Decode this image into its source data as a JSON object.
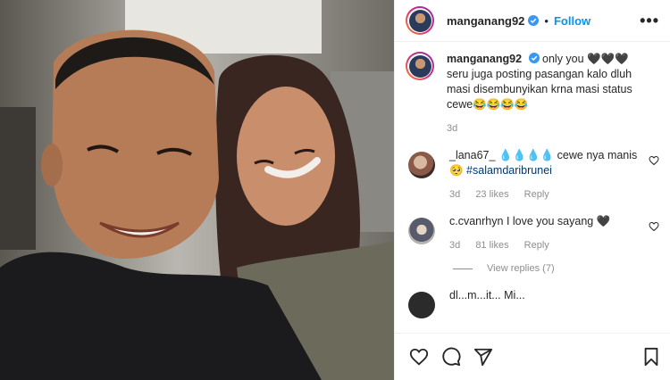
{
  "header": {
    "username": "manganang92",
    "separator": "•",
    "follow_label": "Follow",
    "more_label": "•••"
  },
  "caption": {
    "username": "manganang92",
    "text": "only you 🖤🖤🖤 seru juga posting pasangan kalo dluh masi disembunyikan krna masi status cewe😂😂😂😂",
    "time": "3d"
  },
  "comments": [
    {
      "username": "_lana67_",
      "text": "💧💧💧💧 cewe nya manis 🥺 ",
      "tag": "#salamdaribrunei",
      "time": "3d",
      "likes": "23 likes",
      "reply": "Reply"
    },
    {
      "username": "c.cvanrhyn",
      "text": "I love you sayang 🖤",
      "time": "3d",
      "likes": "81 likes",
      "reply": "Reply",
      "view_replies": "View replies (7)"
    },
    {
      "username": "dl...m...it...",
      "text": "Mi...",
      "time": "",
      "likes": "",
      "reply": ""
    }
  ],
  "icons": [
    "verified-badge-icon",
    "more-options-icon",
    "heart-icon",
    "comment-icon",
    "share-icon",
    "bookmark-icon"
  ],
  "colors": {
    "follow": "#0095f6",
    "tag": "#00376b",
    "meta": "#8e8e8e",
    "verified": "#3897f0"
  }
}
